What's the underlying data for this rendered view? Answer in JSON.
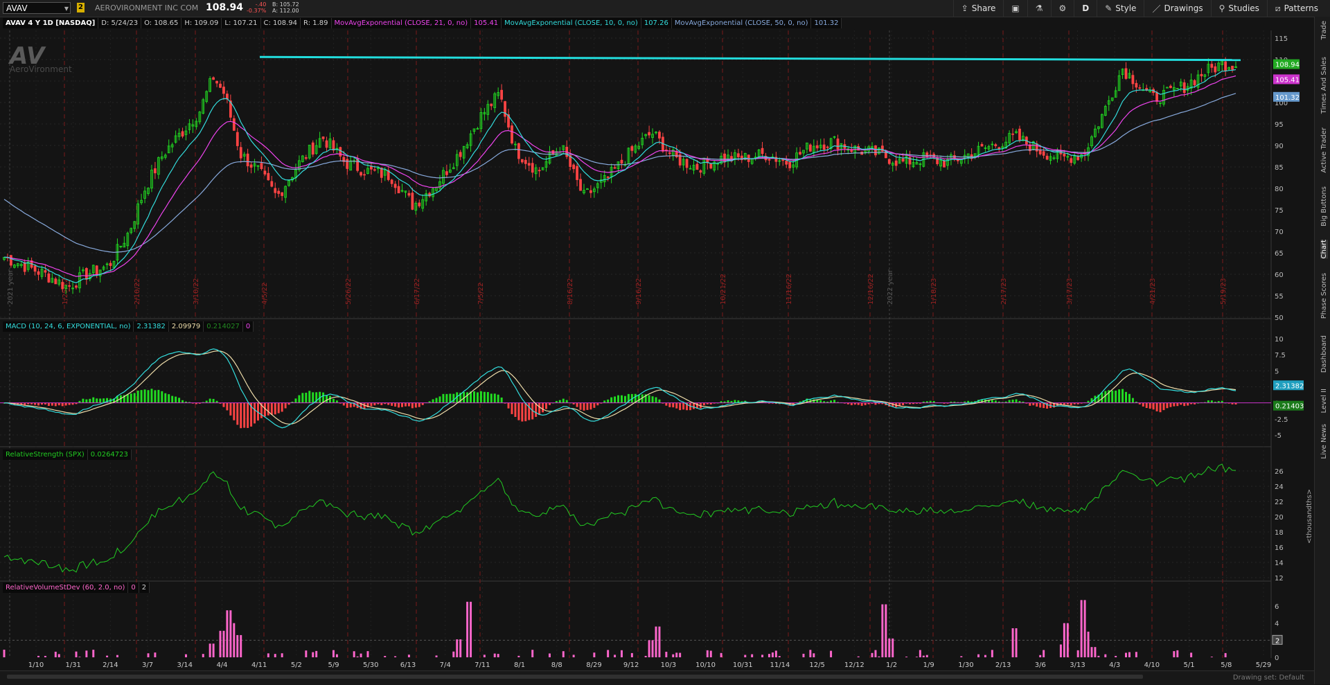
{
  "topbar": {
    "symbol": "AVAV",
    "link_badge": "2",
    "company": "AEROVIRONMENT INC COM",
    "last": "108.94",
    "change_line1": "-.40",
    "change_line2": "-0.37%",
    "bid": "B: 105.72",
    "ask": "A: 112.00",
    "buttons": {
      "share": "Share",
      "d": "D",
      "style": "Style",
      "drawings": "Drawings",
      "studies": "Studies",
      "patterns": "Patterns"
    }
  },
  "sidebar": {
    "tabs": [
      "Trade",
      "Times And Sales",
      "Active Trader",
      "Big Buttons",
      "Chart",
      "Phase Scores",
      "Dashboard",
      "Level II",
      "Live News"
    ]
  },
  "price_pane": {
    "header": {
      "title": "AVAV 4 Y 1D [NASDAQ]",
      "date": "D: 5/24/23",
      "open": "O: 108.65",
      "high": "H: 109.09",
      "low": "L: 107.21",
      "close": "C: 108.94",
      "range": "R: 1.89",
      "ema21_label": "MovAvgExponential (CLOSE, 21, 0, no)",
      "ema21_val": "105.41",
      "ema10_label": "MovAvgExponential (CLOSE, 10, 0, no)",
      "ema10_val": "107.26",
      "ema50_label": "MovAvgExponential (CLOSE, 50, 0, no)",
      "ema50_val": "101.32"
    },
    "logo_text": "AeroVironment",
    "y_ticks": [
      "115",
      "110",
      "105",
      "100",
      "95",
      "90",
      "85",
      "80",
      "75",
      "70",
      "65",
      "60",
      "55",
      "50"
    ],
    "badges": {
      "close": "108.94",
      "ema21": "105.41",
      "ema50": "101.32"
    },
    "year_labels": [
      "2021 year",
      "2022 year"
    ],
    "event_dates": [
      "1/25/22",
      "2/10/22",
      "3/10/22",
      "4/5/22",
      "5/26/22",
      "6/17/22",
      "7/5/22",
      "8/16/22",
      "9/16/22",
      "10/21/22",
      "11/16/22",
      "12/16/22",
      "1/18/23",
      "2/17/23",
      "3/17/23",
      "4/21/23",
      "5/19/23"
    ]
  },
  "macd_pane": {
    "header": {
      "label": "MACD (10, 24, 6, EXPONENTIAL, no)",
      "value": "2.31382",
      "avg": "2.09979",
      "diff": "0.214027",
      "zero": "0"
    },
    "y_ticks": [
      "10",
      "7.5",
      "5",
      "2.5",
      "0",
      "-2.5",
      "-5"
    ],
    "badges": {
      "value": "2.31382",
      "diff": "0.21403"
    }
  },
  "rs_pane": {
    "header": {
      "label": "RelativeStrength (SPX)",
      "value": "0.0264723"
    },
    "y_ticks": [
      "26",
      "24",
      "22",
      "20",
      "18",
      "16",
      "14",
      "12"
    ],
    "unit": "<thousandths>"
  },
  "rv_pane": {
    "header": {
      "label": "RelativeVolumeStDev (60, 2.0, no)",
      "v1": "0",
      "v2": "2"
    },
    "y_ticks": [
      "6",
      "4",
      "2",
      "0"
    ],
    "badge": "2"
  },
  "x_axis": [
    "1/10",
    "1/31",
    "2/14",
    "3/7",
    "3/14",
    "4/4",
    "4/11",
    "5/2",
    "5/9",
    "5/30",
    "6/13",
    "7/4",
    "7/11",
    "8/1",
    "8/8",
    "8/29",
    "9/12",
    "10/3",
    "10/10",
    "10/31",
    "11/14",
    "12/5",
    "12/12",
    "1/2",
    "1/9",
    "1/30",
    "2/13",
    "3/6",
    "3/13",
    "4/3",
    "4/10",
    "5/1",
    "5/8",
    "5/29"
  ],
  "bottom": {
    "drawing_set": "Drawing set: Default"
  },
  "colors": {
    "up": "#22dd22",
    "down": "#ff4444",
    "ema10": "#33dddd",
    "ema21": "#ee44ee",
    "ema50": "#88aadd",
    "resistance": "#22dddd",
    "rs": "#22cc22",
    "rv": "#ff66cc",
    "macd": "#33dddd",
    "macd_avg": "#eeddaa"
  }
}
